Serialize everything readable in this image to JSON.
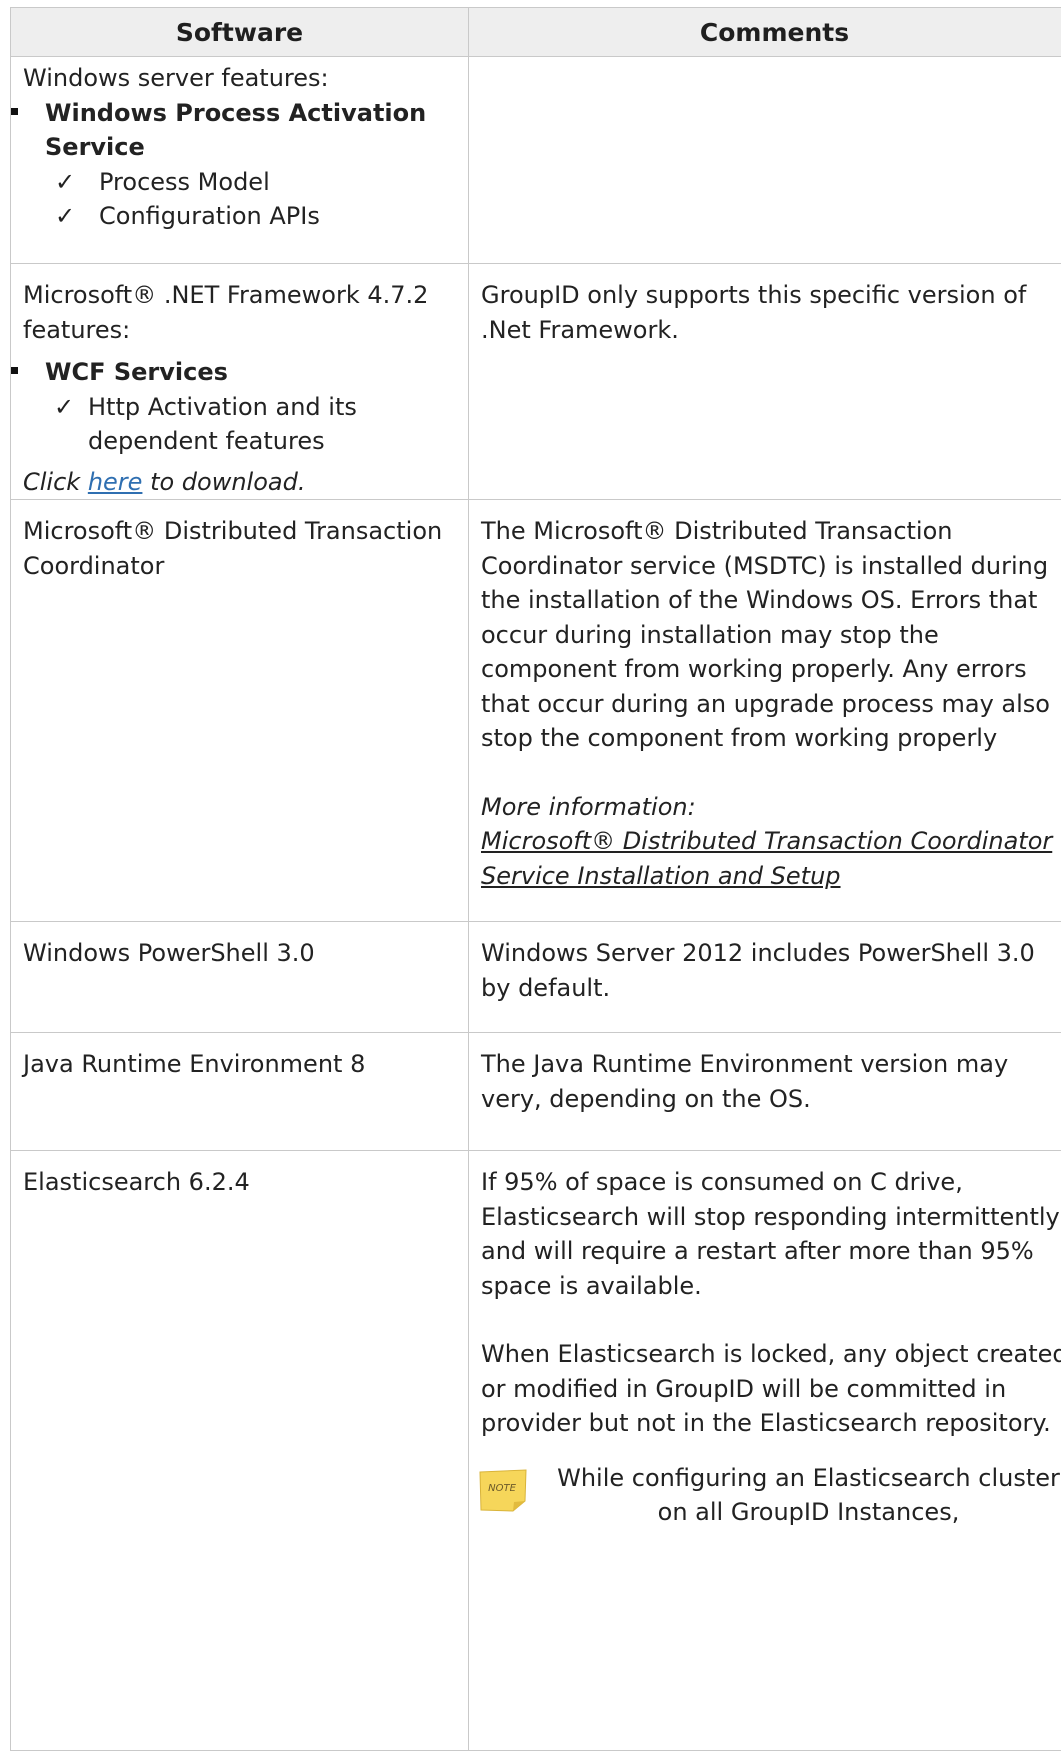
{
  "table": {
    "headers": {
      "software": "Software",
      "comments": "Comments"
    },
    "rows": [
      {
        "software": {
          "intro": "Windows server features:",
          "feature": "Windows Process Activation Service",
          "subfeatures": [
            "Process Model",
            "Configuration APIs"
          ]
        },
        "comments": ""
      },
      {
        "software": {
          "line1": "Microsoft® .NET Framework 4.7.2",
          "line2": "features:",
          "feature": "WCF Services",
          "subfeature": "Http Activation and its dependent features",
          "click_prefix": "Click ",
          "click_link": "here",
          "click_suffix": " to download."
        },
        "comments": {
          "text": "GroupID only supports this specific version of .Net Framework."
        }
      },
      {
        "software": {
          "name": "Microsoft® Distributed Transaction Coordinator"
        },
        "comments": {
          "text": "The Microsoft® Distributed Transaction Coordinator service (MSDTC) is installed during the installation of the Windows OS. Errors that occur during installation may stop the component from working properly. Any errors that occur during an upgrade process may also stop the component from working properly",
          "more_info_label": "More information:",
          "more_info_link": "Microsoft® Distributed Transaction Coordinator Service Installation and Setup"
        }
      },
      {
        "software": {
          "name": "Windows PowerShell 3.0"
        },
        "comments": {
          "text": "Windows Server 2012 includes PowerShell 3.0 by default."
        }
      },
      {
        "software": {
          "name": "Java Runtime Environment 8"
        },
        "comments": {
          "text": "The Java Runtime Environment version may very, depending on the OS."
        }
      },
      {
        "software": {
          "name": "Elasticsearch 6.2.4"
        },
        "comments": {
          "paragraph1": "If 95% of space is consumed on C drive, Elasticsearch will stop responding intermittently and will require a restart after more than 95% space is available.",
          "paragraph2": "When Elasticsearch is locked, any object created or modified in GroupID will be committed in provider but not in the Elasticsearch repository.",
          "note_icon_label": "NOTE",
          "note_text": "While configuring an Elasticsearch cluster on all GroupID Instances,"
        }
      }
    ]
  },
  "icons": {
    "bullet": "square-bullet-icon",
    "check": "checkmark-icon",
    "note": "sticky-note-icon"
  },
  "colors": {
    "link": "#2f6fb1",
    "border": "#c9c9c9",
    "header_bg": "#eeeeee",
    "note_yellow": "#f6d65a"
  }
}
